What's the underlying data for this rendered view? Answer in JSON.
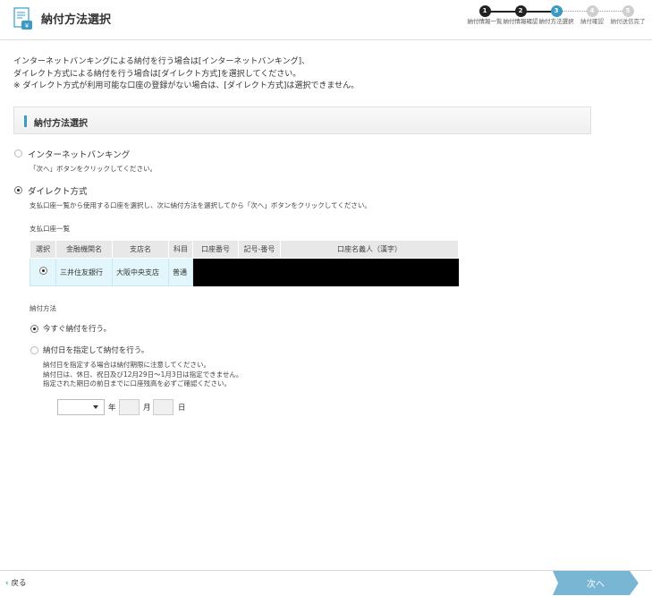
{
  "header": {
    "title": "納付方法選択",
    "steps": [
      {
        "num": "1",
        "label": "納付情報一覧",
        "state": "done"
      },
      {
        "num": "2",
        "label": "納付情報確認",
        "state": "done"
      },
      {
        "num": "3",
        "label": "納付方法選択",
        "state": "current"
      },
      {
        "num": "4",
        "label": "納付確認",
        "state": "todo"
      },
      {
        "num": "5",
        "label": "納付送信完了",
        "state": "todo"
      }
    ]
  },
  "intro": {
    "line1": "インターネットバンキングによる納付を行う場合は[インターネットバンキング]、",
    "line2": "ダイレクト方式による納付を行う場合は[ダイレクト方式]を選択してください。",
    "line3": "※ ダイレクト方式が利用可能な口座の登録がない場合は、[ダイレクト方式]は選択できません。"
  },
  "section_title": "納付方法選択",
  "option_internet": {
    "label": "インターネットバンキング",
    "note": "「次へ」ボタンをクリックしてください。",
    "selected": false
  },
  "option_direct": {
    "label": "ダイレクト方式",
    "note": "支払口座一覧から使用する口座を選択し、次に納付方法を選択してから「次へ」ボタンをクリックしてください。",
    "selected": true
  },
  "account_list": {
    "title": "支払口座一覧",
    "headers": [
      "選択",
      "金融機関名",
      "支店名",
      "科目",
      "口座番号",
      "記号-番号",
      "口座名義人（漢字）"
    ],
    "rows": [
      {
        "bank": "三井住友銀行",
        "branch": "大阪中央支店",
        "type": "普通",
        "selected": true
      }
    ]
  },
  "payment_method": {
    "title": "納付方法",
    "now_label": "今すぐ納付を行う。",
    "scheduled_label": "納付日を指定して納付を行う。",
    "note1": "納付日を指定する場合は納付期限に注意してください。",
    "note2": "納付日は、休日、祝日及び12月29日〜1月3日は指定できません。",
    "note3": "指定された期日の前日までに口座残高を必ずご確認ください。",
    "year_unit": "年",
    "month_unit": "月",
    "day_unit": "日"
  },
  "footer": {
    "back_label": "戻る",
    "next_label": "次へ"
  },
  "colors": {
    "accent": "#3a9bc4",
    "row_highlight": "#e3f6fb"
  }
}
